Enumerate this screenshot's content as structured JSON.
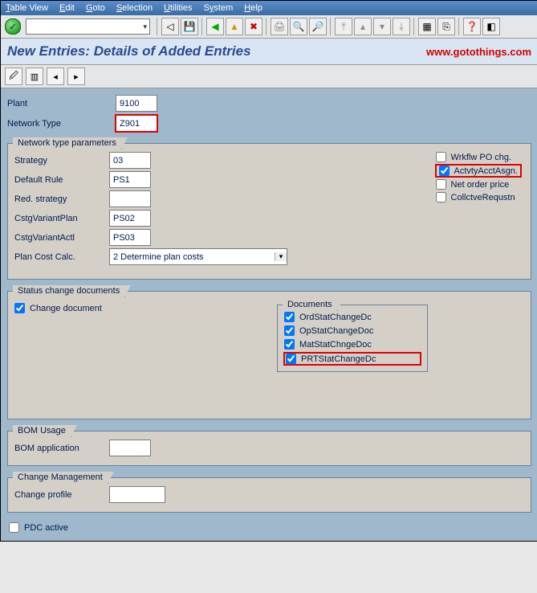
{
  "menubar": {
    "table_view": "Table View",
    "edit": "Edit",
    "goto": "Goto",
    "selection": "Selection",
    "utilities": "Utilities",
    "system": "System",
    "help": "Help"
  },
  "title": "New Entries: Details of Added Entries",
  "website": "www.gotothings.com",
  "header": {
    "plant_label": "Plant",
    "plant": "9100",
    "network_type_label": "Network Type",
    "network_type": "Z901"
  },
  "groups": {
    "network_params": {
      "title": "Network type parameters",
      "strategy_label": "Strategy",
      "strategy": "03",
      "default_rule_label": "Default Rule",
      "default_rule": "PS1",
      "red_strategy_label": "Red. strategy",
      "red_strategy": "",
      "cstg_plan_label": "CstgVariantPlan",
      "cstg_plan": "PS02",
      "cstg_actl_label": "CstgVariantActl",
      "cstg_actl": "PS03",
      "plan_cost_label": "Plan Cost Calc.",
      "plan_cost": "2 Determine plan costs",
      "right": {
        "wrkflw": "Wrkflw PO chg.",
        "actvty": "ActvtyAcctAsgn.",
        "netorder": "Net order price",
        "collctve": "CollctveRequstn"
      }
    },
    "status": {
      "title": "Status change documents",
      "change_doc": "Change document",
      "documents": {
        "title": "Documents",
        "ord": "OrdStatChangeDc",
        "op": "OpStatChangeDoc",
        "mat": "MatStatChngeDoc",
        "prt": "PRTStatChangeDc"
      }
    },
    "bom": {
      "title": "BOM Usage",
      "app_label": "BOM application",
      "app": ""
    },
    "change_mgmt": {
      "title": "Change Management",
      "profile_label": "Change profile",
      "profile": ""
    }
  },
  "pdc": {
    "label": "PDC active"
  }
}
